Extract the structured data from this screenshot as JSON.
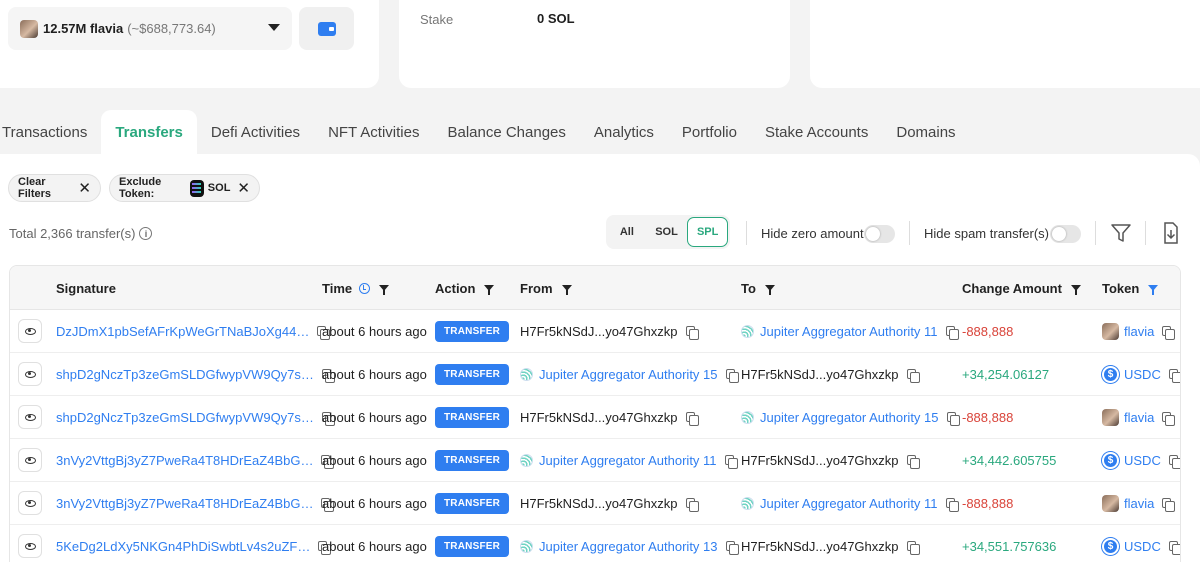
{
  "wallet": {
    "amount": "12.57M flavia",
    "usd": "(~$688,773.64)"
  },
  "stake": {
    "label": "Stake",
    "value": "0 SOL"
  },
  "tabs": [
    {
      "label": "Transactions"
    },
    {
      "label": "Transfers"
    },
    {
      "label": "Defi Activities"
    },
    {
      "label": "NFT Activities"
    },
    {
      "label": "Balance Changes"
    },
    {
      "label": "Analytics"
    },
    {
      "label": "Portfolio"
    },
    {
      "label": "Stake Accounts"
    },
    {
      "label": "Domains"
    }
  ],
  "filters": {
    "clear_label": "Clear Filters",
    "exclude_label": "Exclude Token:",
    "exclude_token": "SOL"
  },
  "total": "Total 2,366 transfer(s)",
  "segment": {
    "all": "All",
    "sol": "SOL",
    "spl": "SPL"
  },
  "toggles": {
    "hide_zero": "Hide zero amount",
    "hide_spam": "Hide spam transfer(s)"
  },
  "table": {
    "headers": {
      "signature": "Signature",
      "time": "Time",
      "action": "Action",
      "from": "From",
      "to": "To",
      "change": "Change Amount",
      "token": "Token"
    },
    "rows": [
      {
        "signature": "DzJDmX1pbSefAFrKpWeGrTNaBJoXg44…",
        "time": "about 6 hours ago",
        "action": "TRANSFER",
        "from": "H7Fr5kNSdJ...yo47Ghxzkp",
        "to": "Jupiter Aggregator Authority 11",
        "change": "-888,888",
        "token": "flavia"
      },
      {
        "signature": "shpD2gNczTp3zeGmSLDGfwypVW9Qy7s…",
        "time": "about 6 hours ago",
        "action": "TRANSFER",
        "from": "Jupiter Aggregator Authority 15",
        "to": "H7Fr5kNSdJ...yo47Ghxzkp",
        "change": "+34,254.06127",
        "token": "USDC"
      },
      {
        "signature": "shpD2gNczTp3zeGmSLDGfwypVW9Qy7s…",
        "time": "about 6 hours ago",
        "action": "TRANSFER",
        "from": "H7Fr5kNSdJ...yo47Ghxzkp",
        "to": "Jupiter Aggregator Authority 15",
        "change": "-888,888",
        "token": "flavia"
      },
      {
        "signature": "3nVy2VttgBj3yZ7PweRa4T8HDrEaZ4BbG…",
        "time": "about 6 hours ago",
        "action": "TRANSFER",
        "from": "Jupiter Aggregator Authority 11",
        "to": "H7Fr5kNSdJ...yo47Ghxzkp",
        "change": "+34,442.605755",
        "token": "USDC"
      },
      {
        "signature": "3nVy2VttgBj3yZ7PweRa4T8HDrEaZ4BbG…",
        "time": "about 6 hours ago",
        "action": "TRANSFER",
        "from": "H7Fr5kNSdJ...yo47Ghxzkp",
        "to": "Jupiter Aggregator Authority 11",
        "change": "-888,888",
        "token": "flavia"
      },
      {
        "signature": "5KeDg2LdXy5NKGn4PhDiSwbtLv4s2uZF…",
        "time": "about 6 hours ago",
        "action": "TRANSFER",
        "from": "Jupiter Aggregator Authority 13",
        "to": "H7Fr5kNSdJ...yo47Ghxzkp",
        "change": "+34,551.757636",
        "token": "USDC"
      }
    ]
  },
  "colors": {
    "accent_green": "#2aa87e",
    "link_blue": "#2f7ef0",
    "negative_red": "#d9443a"
  },
  "icons": [
    "wallet-icon",
    "caret-down-icon",
    "close-icon",
    "sol-token-icon",
    "info-icon",
    "filter-icon",
    "download-icon",
    "eye-icon",
    "copy-icon",
    "clock-icon",
    "jupiter-icon",
    "usdc-icon"
  ]
}
